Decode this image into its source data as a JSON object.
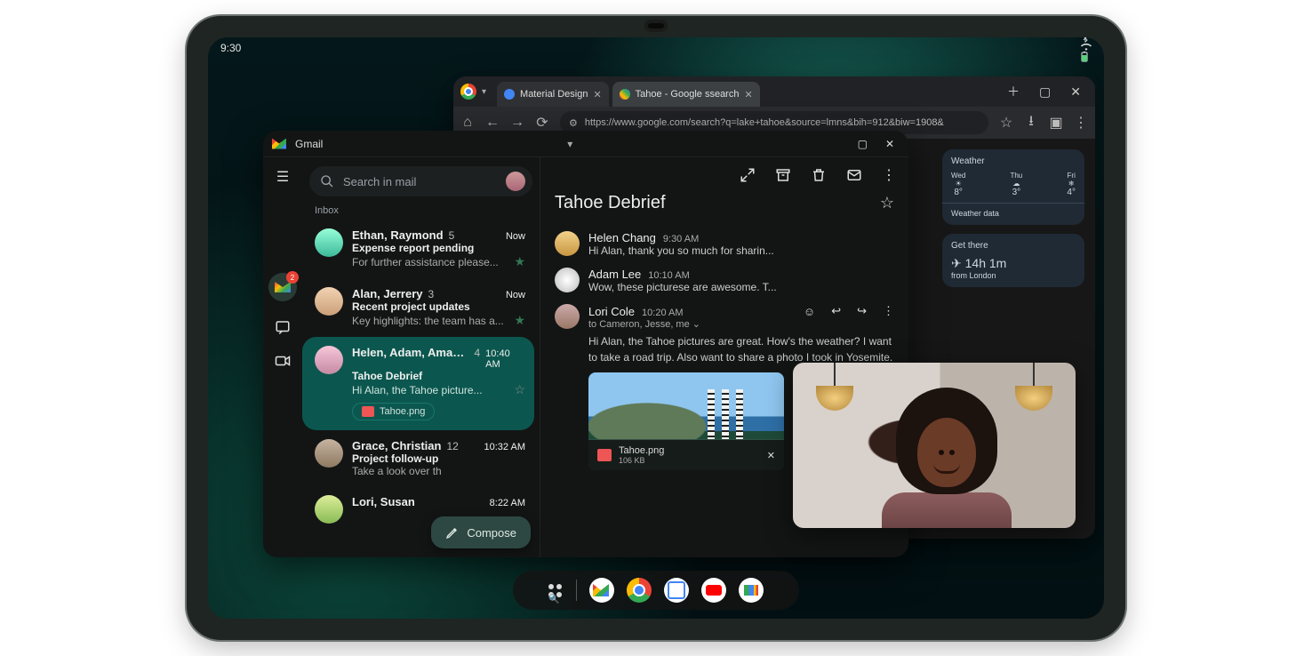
{
  "status": {
    "time": "9:30"
  },
  "chrome": {
    "tabs": [
      {
        "label": "Material Design"
      },
      {
        "label": "Tahoe - Google ssearch"
      }
    ],
    "url": "https://www.google.com/search?q=lake+tahoe&source=lmns&bih=912&biw=1908&",
    "weather_card": {
      "title": "Weather",
      "days": [
        {
          "day": "Wed",
          "deg": "8°",
          "icon": "sun"
        },
        {
          "day": "Thu",
          "deg": "3°",
          "icon": "cloud"
        },
        {
          "day": "Fri",
          "deg": "4°",
          "icon": "snow"
        }
      ],
      "footer": "Weather data"
    },
    "travel_card": {
      "title": "Get there",
      "duration": "14h 1m",
      "from": "from London"
    }
  },
  "gmail": {
    "app_name": "Gmail",
    "search_placeholder": "Search in mail",
    "inbox_label": "Inbox",
    "rail_badge": "2",
    "compose": "Compose",
    "threads": [
      {
        "sender": "Ethan, Raymond",
        "count": "5",
        "time": "Now",
        "subject": "Expense report pending",
        "preview": "For further assistance please...",
        "starred": true
      },
      {
        "sender": "Alan, Jerrery",
        "count": "3",
        "time": "Now",
        "subject": "Recent project updates",
        "preview": "Key highlights: the team has a...",
        "starred": true
      },
      {
        "sender": "Helen, Adam, Amanda",
        "count": "4",
        "time": "10:40 AM",
        "subject": "Tahoe Debrief",
        "preview": "Hi Alan, the Tahoe picture...",
        "starred": false,
        "selected": true,
        "attachment": "Tahoe.png"
      },
      {
        "sender": "Grace, Christian",
        "count": "12",
        "time": "10:32 AM",
        "subject": "Project follow-up",
        "preview": "Take a look over th"
      },
      {
        "sender": "Lori, Susan",
        "count": "",
        "time": "8:22 AM",
        "subject": "",
        "preview": ""
      }
    ],
    "open": {
      "subject": "Tahoe Debrief",
      "messages": [
        {
          "from": "Helen Chang",
          "time": "9:30 AM",
          "line": "Hi Alan, thank you so much for sharin..."
        },
        {
          "from": "Adam Lee",
          "time": "10:10 AM",
          "line": "Wow, these picturese are awesome. T..."
        },
        {
          "from": "Lori Cole",
          "time": "10:20 AM",
          "sub": "to Cameron, Jesse, me",
          "body": "Hi Alan, the Tahoe pictures are great. How's the weather? I want to take a road trip. Also want to share a photo I took in Yosemite.",
          "attachment": {
            "name": "Tahoe.png",
            "size": "106 KB"
          }
        }
      ]
    }
  }
}
